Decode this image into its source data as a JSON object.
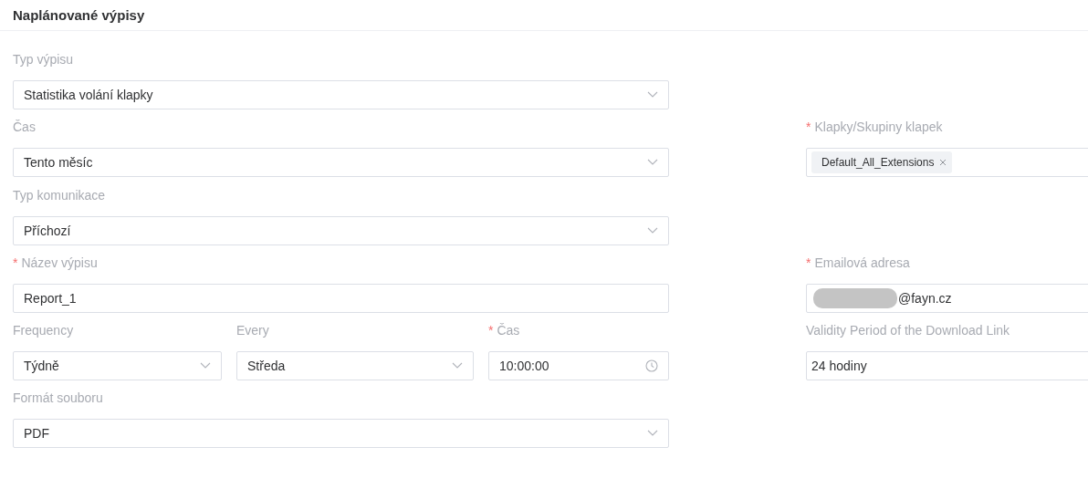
{
  "title": "Naplánované výpisy",
  "rows": [
    {
      "left": [
        {
          "kind": "select",
          "label": "Typ výpisu",
          "value": "Statistika volání klapky"
        }
      ]
    },
    {
      "left": [
        {
          "kind": "select",
          "label": "Čas",
          "value": "Tento měsíc"
        }
      ],
      "right": {
        "kind": "tags",
        "label": "Klapky/Skupiny klapek",
        "required_mark": "*",
        "tags": [
          "Default_All_Extensions"
        ]
      }
    },
    {
      "left": [
        {
          "kind": "select",
          "label": "Typ komunikace",
          "value": "Příchozí"
        }
      ]
    },
    {
      "left": [
        {
          "kind": "text",
          "label": "Název výpisu",
          "required_mark": "*",
          "value": "Report_1"
        }
      ],
      "right": {
        "kind": "text",
        "label": "Emailová adresa",
        "required_mark": "*",
        "value": "@fayn.cz",
        "redacted": true
      }
    },
    {
      "left": [
        {
          "kind": "select",
          "label": "Frequency",
          "value": "Týdně"
        },
        {
          "kind": "select",
          "label": "Every",
          "value": "Středa"
        },
        {
          "kind": "time",
          "label": "Čas",
          "required_mark": "*",
          "value": "10:00:00"
        }
      ],
      "right": {
        "kind": "text",
        "label": "Validity Period of the Download Link",
        "value": "24 hodiny"
      }
    },
    {
      "left": [
        {
          "kind": "select",
          "label": "Formát souboru",
          "value": "PDF"
        }
      ]
    }
  ]
}
